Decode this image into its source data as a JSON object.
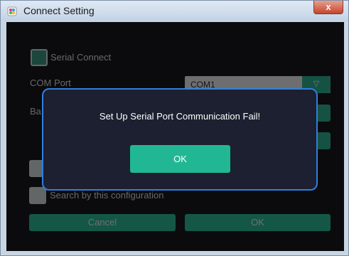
{
  "window": {
    "title": "Connect Setting",
    "close_glyph": "x",
    "app_icon": "app-logo-icon"
  },
  "form": {
    "serial_connect_label": "Serial Connect",
    "com_port_label": "COM Port",
    "com_port_value": "COM1",
    "baud_label": "Ba",
    "search_label": "Search by this configuration",
    "cancel_label": "Cancel",
    "ok_label": "OK",
    "dropdown_glyph": "▽"
  },
  "dialog": {
    "message": "Set Up Serial Port Communication Fail!",
    "ok_label": "OK"
  },
  "colors": {
    "accent": "#22b794",
    "dialog_border": "#2f7fe0",
    "dialog_bg": "#1c2030"
  }
}
